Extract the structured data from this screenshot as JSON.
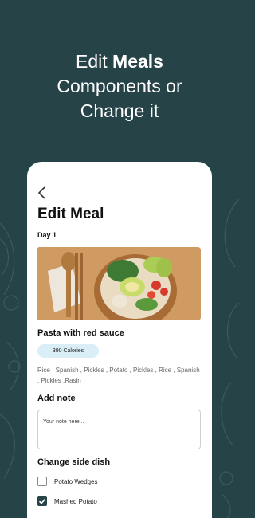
{
  "promo": {
    "line1_prefix": "Edit ",
    "line1_bold": "Meals",
    "line2": "Components or",
    "line3": "Change it"
  },
  "screen": {
    "title": "Edit Meal",
    "day": "Day 1",
    "meal_name": "Pasta with red sauce",
    "calories": "390 Calories",
    "ingredients": "Rice , Spanish , Pickles , Potato , Pickles , Rice , Spanish , Pickles ,Rasin",
    "add_note_label": "Add note",
    "note_placeholder": "Your note here...",
    "side_dish_label": "Change side dish",
    "side_options": [
      {
        "label": "Potato Wedges",
        "checked": false
      },
      {
        "label": "Mashed Potato",
        "checked": true
      }
    ]
  },
  "colors": {
    "background": "#264348",
    "badge": "#d9eef6"
  }
}
